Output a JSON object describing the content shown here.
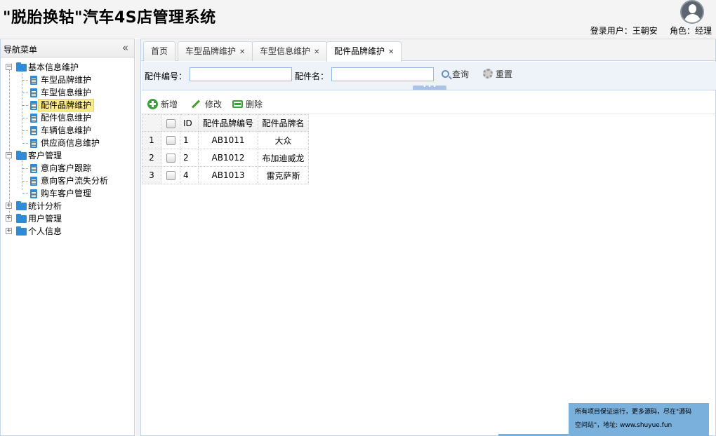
{
  "header": {
    "title": "\"脱胎换轱\"汽车4S店管理系统",
    "user_label": "登录用户：王朝安",
    "role_label": "角色：经理"
  },
  "sidebar": {
    "title": "导航菜单",
    "collapse_glyph": "«",
    "groups": [
      {
        "label": "基本信息维护",
        "expanded": true,
        "items": [
          "车型品牌维护",
          "车型信息维护",
          "配件品牌维护",
          "配件信息维护",
          "车辆信息维护",
          "供应商信息维护"
        ]
      },
      {
        "label": "客户管理",
        "expanded": true,
        "items": [
          "意向客户跟踪",
          "意向客户流失分析",
          "购车客户管理"
        ]
      },
      {
        "label": "统计分析",
        "expanded": false,
        "items": []
      },
      {
        "label": "用户管理",
        "expanded": false,
        "items": []
      },
      {
        "label": "个人信息",
        "expanded": false,
        "items": []
      }
    ],
    "selected_item": "配件品牌维护"
  },
  "tabs": [
    {
      "label": "首页",
      "closable": false,
      "active": false
    },
    {
      "label": "车型品牌维护",
      "closable": true,
      "active": false
    },
    {
      "label": "车型信息维护",
      "closable": true,
      "active": false
    },
    {
      "label": "配件品牌维护",
      "closable": true,
      "active": true
    }
  ],
  "search": {
    "code_label": "配件编号：",
    "code_value": "",
    "name_label": "配件名：",
    "name_value": "",
    "query_label": "查询",
    "reset_label": "重置"
  },
  "toolbar": {
    "add_label": "新增",
    "edit_label": "修改",
    "delete_label": "删除"
  },
  "grid": {
    "columns": [
      "ID",
      "配件品牌编号",
      "配件品牌名"
    ],
    "rows": [
      {
        "rownum": "1",
        "id": "1",
        "code": "AB1011",
        "name": "大众"
      },
      {
        "rownum": "2",
        "id": "2",
        "code": "AB1012",
        "name": "布加迪威龙"
      },
      {
        "rownum": "3",
        "id": "4",
        "code": "AB1013",
        "name": "雷克萨斯"
      }
    ]
  },
  "ad": {
    "line1": "所有项目保证运行，更多源码，尽在\"源码",
    "line2": "空间站\"，地址: www.shuyue.fun"
  },
  "colors": {
    "accent_blue": "#2d8bd7",
    "panel_border": "#c5d5e8",
    "selected_bg": "#fbec88",
    "ad_bg": "#7ab0dc"
  }
}
